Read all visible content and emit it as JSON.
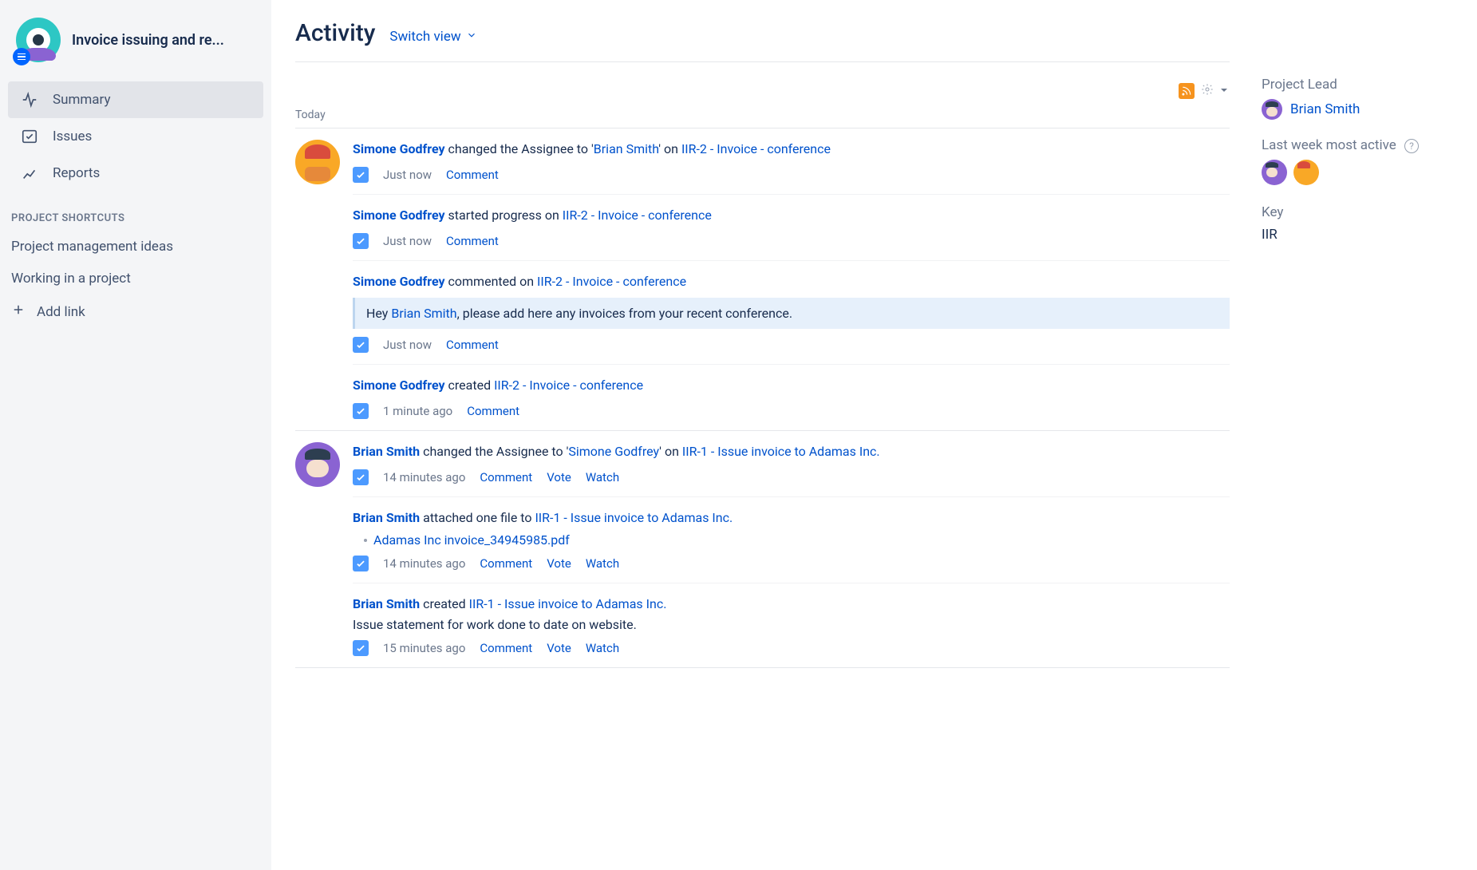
{
  "project": {
    "title": "Invoice issuing and re..."
  },
  "sidebar": {
    "nav": [
      {
        "label": "Summary",
        "icon": "activity-icon",
        "active": true
      },
      {
        "label": "Issues",
        "icon": "issues-icon",
        "active": false
      },
      {
        "label": "Reports",
        "icon": "reports-icon",
        "active": false
      }
    ],
    "shortcuts_heading": "PROJECT SHORTCUTS",
    "shortcuts": [
      "Project management ideas",
      "Working in a project"
    ],
    "add_link_label": "Add link"
  },
  "header": {
    "title": "Activity",
    "switch_view_label": "Switch view"
  },
  "stream": {
    "day_heading": "Today",
    "groups": [
      {
        "avatar": "simone",
        "entries": [
          {
            "actor": "Simone Godfrey",
            "verb_pre": " changed the Assignee to '",
            "mention": "Brian Smith",
            "verb_post": "' on ",
            "issue": "IIR-2 - Invoice - conference",
            "time": "Just now",
            "actions": [
              "Comment"
            ]
          },
          {
            "actor": "Simone Godfrey",
            "verb_pre": " started progress on ",
            "issue": "IIR-2 - Invoice - conference",
            "time": "Just now",
            "actions": [
              "Comment"
            ]
          },
          {
            "actor": "Simone Godfrey",
            "verb_pre": " commented on ",
            "issue": "IIR-2 - Invoice - conference",
            "comment_pre": "Hey ",
            "comment_mention": "Brian Smith",
            "comment_post": ", please add here any invoices from your recent conference.",
            "time": "Just now",
            "actions": [
              "Comment"
            ]
          },
          {
            "actor": "Simone Godfrey",
            "verb_pre": " created ",
            "issue": "IIR-2 - Invoice - conference",
            "time": "1 minute ago",
            "actions": [
              "Comment"
            ]
          }
        ]
      },
      {
        "avatar": "brian",
        "entries": [
          {
            "actor": "Brian Smith",
            "verb_pre": " changed the Assignee to '",
            "mention": "Simone Godfrey",
            "verb_post": "' on ",
            "issue": "IIR-1 - Issue invoice to Adamas Inc.",
            "time": "14 minutes ago",
            "actions": [
              "Comment",
              "Vote",
              "Watch"
            ]
          },
          {
            "actor": "Brian Smith",
            "verb_pre": " attached one file to ",
            "issue": "IIR-1 - Issue invoice to Adamas Inc.",
            "attachment": "Adamas Inc invoice_34945985.pdf",
            "time": "14 minutes ago",
            "actions": [
              "Comment",
              "Vote",
              "Watch"
            ]
          },
          {
            "actor": "Brian Smith",
            "verb_pre": " created ",
            "issue": "IIR-1 - Issue invoice to Adamas Inc.",
            "description": "Issue statement for work done to date on website.",
            "time": "15 minutes ago",
            "actions": [
              "Comment",
              "Vote",
              "Watch"
            ]
          }
        ]
      }
    ]
  },
  "rightside": {
    "lead_label": "Project Lead",
    "lead_name": "Brian Smith",
    "active_label": "Last week most active",
    "active_avatars": [
      "brian",
      "simone"
    ],
    "key_label": "Key",
    "key_value": "IIR"
  }
}
